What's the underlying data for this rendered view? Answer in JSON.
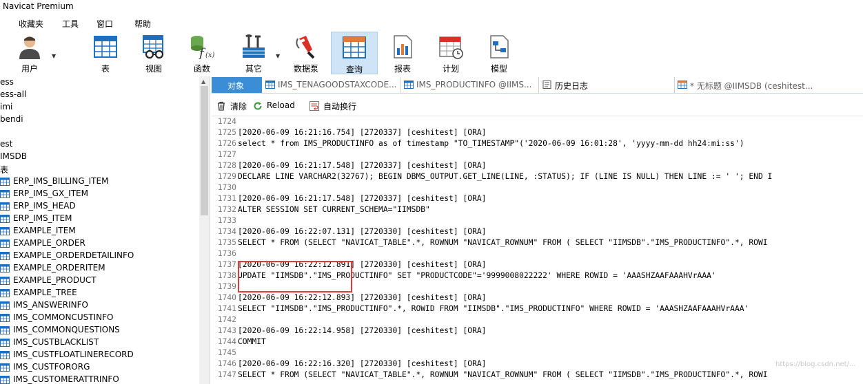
{
  "app": {
    "title": "Navicat Premium"
  },
  "menu": [
    "收藏夹",
    "工具",
    "窗口",
    "帮助"
  ],
  "toolbar": [
    {
      "label": "用户",
      "icon": "user-icon",
      "dropdown": true
    },
    {
      "label": "表",
      "icon": "table-icon"
    },
    {
      "label": "视图",
      "icon": "view-icon"
    },
    {
      "label": "函数",
      "icon": "function-icon"
    },
    {
      "label": "其它",
      "icon": "tools-icon",
      "dropdown": true
    },
    {
      "label": "数据泵",
      "icon": "data-pump-icon"
    },
    {
      "label": "查询",
      "icon": "query-icon",
      "active": true
    },
    {
      "label": "报表",
      "icon": "report-icon"
    },
    {
      "label": "计划",
      "icon": "schedule-icon"
    },
    {
      "label": "模型",
      "icon": "model-icon"
    }
  ],
  "sidebar": {
    "connections": [
      "ess",
      "ess-all",
      "imi",
      "bendi",
      "",
      "est",
      "IMSDB",
      "表"
    ],
    "tables": [
      "ERP_IMS_BILLING_ITEM",
      "ERP_IMS_GX_ITEM",
      "ERP_IMS_HEAD",
      "ERP_IMS_ITEM",
      "EXAMPLE_ITEM",
      "EXAMPLE_ORDER",
      "EXAMPLE_ORDERDETAILINFO",
      "EXAMPLE_ORDERITEM",
      "EXAMPLE_PRODUCT",
      "EXAMPLE_TREE",
      "IMS_ANSWERINFO",
      "IMS_COMMONCUSTINFO",
      "IMS_COMMONQUESTIONS",
      "IMS_CUSTBLACKLIST",
      "IMS_CUSTFLOATLINERECORD",
      "IMS_CUSTFORORG",
      "IMS_CUSTOMERATTRINFO"
    ]
  },
  "tabs": [
    {
      "label": "对象",
      "kind": "objects"
    },
    {
      "label": "IMS_TENAGOODSTAXCODE...",
      "kind": "table"
    },
    {
      "label": "IMS_PRODUCTINFO @IIMS...",
      "kind": "table"
    },
    {
      "label": "历史日志",
      "kind": "log"
    },
    {
      "label": "* 无标题 @IIMSDB (ceshitest...",
      "kind": "query"
    }
  ],
  "log_toolbar": {
    "clear": "清除",
    "reload": "Reload",
    "wrap": "自动换行"
  },
  "log_lines": [
    {
      "n": "1724",
      "t": ""
    },
    {
      "n": "1725",
      "t": "[2020-06-09 16:21:16.754] [2720337] [ceshitest] [ORA]"
    },
    {
      "n": "1726",
      "t": "select * from IMS_PRODUCTINFO as of timestamp \"TO_TIMESTAMP\"('2020-06-09 16:01:28', 'yyyy-mm-dd hh24:mi:ss')"
    },
    {
      "n": "1727",
      "t": ""
    },
    {
      "n": "1728",
      "t": "[2020-06-09 16:21:17.548] [2720337] [ceshitest] [ORA]"
    },
    {
      "n": "1729",
      "t": "DECLARE LINE VARCHAR2(32767); BEGIN DBMS_OUTPUT.GET_LINE(LINE, :STATUS); IF (LINE IS NULL) THEN LINE := ' '; END I"
    },
    {
      "n": "1730",
      "t": ""
    },
    {
      "n": "1731",
      "t": "[2020-06-09 16:21:17.548] [2720337] [ceshitest] [ORA]"
    },
    {
      "n": "1732",
      "t": "ALTER SESSION SET CURRENT_SCHEMA=\"IIMSDB\""
    },
    {
      "n": "1733",
      "t": ""
    },
    {
      "n": "1734",
      "t": "[2020-06-09 16:22:07.131] [2720330] [ceshitest] [ORA]"
    },
    {
      "n": "1735",
      "t": "SELECT * FROM (SELECT \"NAVICAT_TABLE\".*, ROWNUM \"NAVICAT_ROWNUM\" FROM ( SELECT \"IIMSDB\".\"IMS_PRODUCTINFO\".*, ROWI"
    },
    {
      "n": "1736",
      "t": ""
    },
    {
      "n": "1737",
      "t": "[2020-06-09 16:22:12.891] [2720330] [ceshitest] [ORA]"
    },
    {
      "n": "1738",
      "t": "UPDATE \"IIMSDB\".\"IMS_PRODUCTINFO\" SET \"PRODUCTCODE\"='9999008022222' WHERE ROWID = 'AAASHZAAFAAAHVrAAA'"
    },
    {
      "n": "1739",
      "t": ""
    },
    {
      "n": "1740",
      "t": "[2020-06-09 16:22:12.893] [2720330] [ceshitest] [ORA]"
    },
    {
      "n": "1741",
      "t": "SELECT \"IIMSDB\".\"IMS_PRODUCTINFO\".*, ROWID FROM \"IIMSDB\".\"IMS_PRODUCTINFO\" WHERE ROWID = 'AAASHZAAFAAAHVrAAA'"
    },
    {
      "n": "1742",
      "t": ""
    },
    {
      "n": "1743",
      "t": "[2020-06-09 16:22:14.958] [2720330] [ceshitest] [ORA]"
    },
    {
      "n": "1744",
      "t": "COMMIT"
    },
    {
      "n": "1745",
      "t": ""
    },
    {
      "n": "1746",
      "t": "[2020-06-09 16:22:16.320] [2720330] [ceshitest] [ORA]"
    },
    {
      "n": "1747",
      "t": "SELECT * FROM (SELECT \"NAVICAT_TABLE\".*, ROWNUM \"NAVICAT_ROWNUM\" FROM ( SELECT \"IIMSDB\".\"IMS_PRODUCTINFO\".*, ROWI"
    }
  ],
  "colors": {
    "accent": "#3b8ed6",
    "active_tool": "#cfe4f6",
    "highlight_box": "#e53935"
  }
}
